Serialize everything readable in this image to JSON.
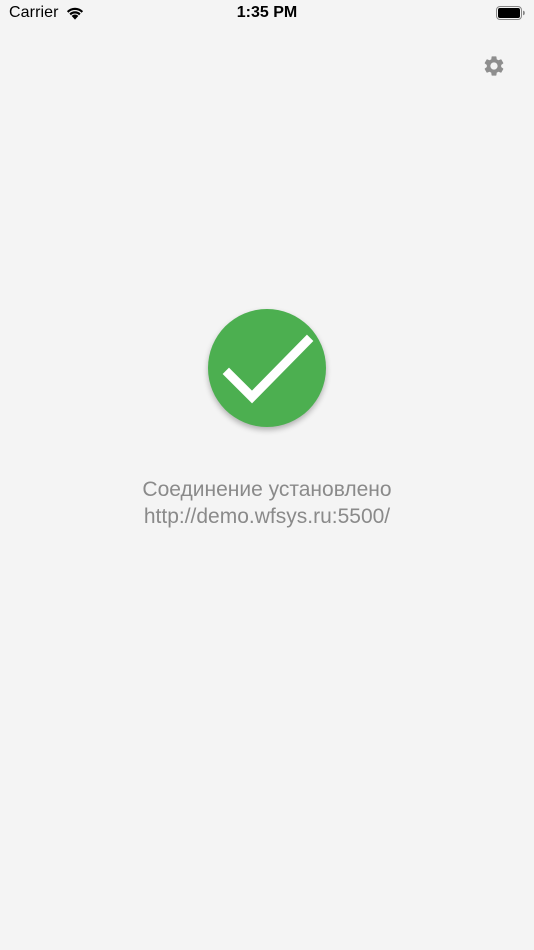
{
  "status_bar": {
    "carrier": "Carrier",
    "time": "1:35 PM",
    "wifi_icon": "wifi-icon",
    "battery_icon": "battery-icon"
  },
  "toolbar": {
    "settings_icon": "gear-icon"
  },
  "connection": {
    "status_icon": "checkmark-circle-icon",
    "status_color": "#4caf50",
    "message": "Соединение установлено",
    "url": "http://demo.wfsys.ru:5500/"
  },
  "colors": {
    "background": "#f4f4f4",
    "text_secondary": "#8a8a8a",
    "icon_gray": "#8e8e8e"
  }
}
